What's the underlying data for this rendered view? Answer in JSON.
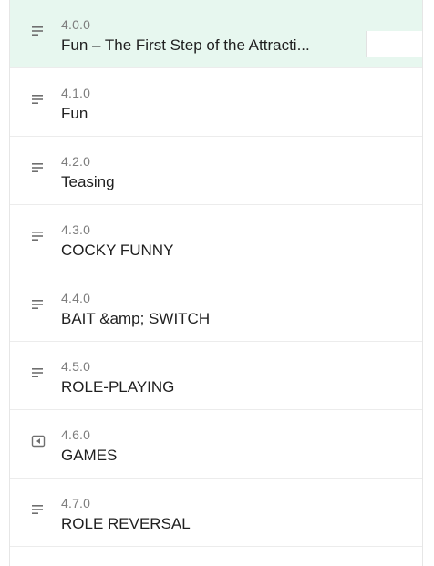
{
  "lessons": [
    {
      "number": "4.0.0",
      "title": "Fun – The First Step of the Attracti...",
      "icon": "list-lines-icon",
      "active": true
    },
    {
      "number": "4.1.0",
      "title": "Fun",
      "icon": "list-lines-icon",
      "active": false
    },
    {
      "number": "4.2.0",
      "title": "Teasing",
      "icon": "list-lines-icon",
      "active": false
    },
    {
      "number": "4.3.0",
      "title": "COCKY FUNNY",
      "icon": "list-lines-icon",
      "active": false
    },
    {
      "number": "4.4.0",
      "title": "BAIT &amp; SWITCH",
      "icon": "list-lines-icon",
      "active": false
    },
    {
      "number": "4.5.0",
      "title": "ROLE-PLAYING",
      "icon": "list-lines-icon",
      "active": false
    },
    {
      "number": "4.6.0",
      "title": "GAMES",
      "icon": "media-back-icon",
      "active": false
    },
    {
      "number": "4.7.0",
      "title": "ROLE REVERSAL",
      "icon": "list-lines-icon",
      "active": false
    }
  ],
  "colors": {
    "active_background": "#e7f7ef",
    "icon": "#6f6f6f",
    "number_text": "#7d7d7d",
    "title_text": "#1f1f1f"
  }
}
